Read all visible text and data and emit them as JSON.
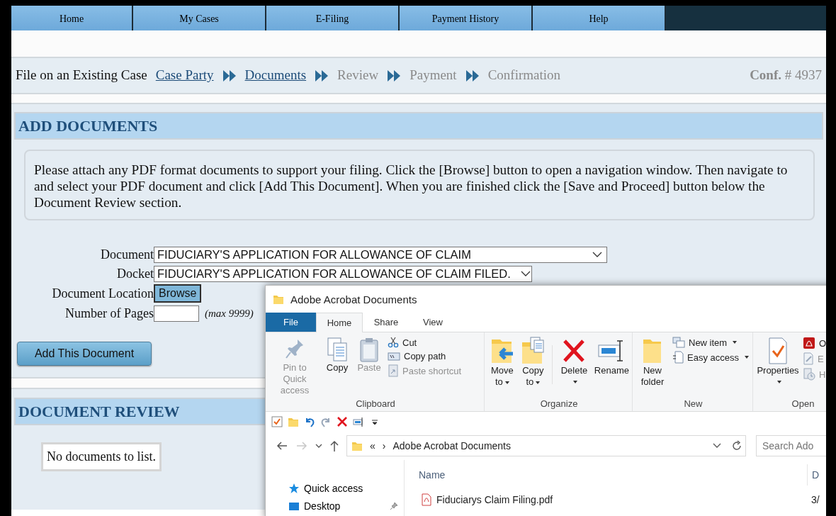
{
  "top_nav": [
    {
      "label": "Home"
    },
    {
      "label": "My Cases"
    },
    {
      "label": "E-Filing"
    },
    {
      "label": "Payment History"
    },
    {
      "label": "Help"
    }
  ],
  "breadcrumb": {
    "title": "File on an Existing Case",
    "steps": [
      {
        "label": "Case Party",
        "done": true
      },
      {
        "label": "Documents",
        "done": true
      },
      {
        "label": "Review",
        "done": false
      },
      {
        "label": "Payment",
        "done": false
      },
      {
        "label": "Confirmation",
        "done": false
      }
    ],
    "conf_label": "Conf.",
    "conf_number": "# 4937"
  },
  "add_documents": {
    "heading": "ADD DOCUMENTS",
    "instructions": "Please attach any PDF format documents to support your filing. Click the [Browse] button to open a navigation window. Then navigate to and select your PDF document and click [Add This Document]. When you are finished click the [Save and Proceed] button below the Document Review section.",
    "fields": [
      {
        "kind": "select",
        "label": "Document",
        "value": "FIDUCIARY'S APPLICATION FOR ALLOWANCE OF CLAIM"
      },
      {
        "kind": "select",
        "label": "Docket",
        "value": "FIDUCIARY'S APPLICATION FOR ALLOWANCE OF CLAIM FILED."
      },
      {
        "kind": "file",
        "label": "Document Location",
        "button": "Browse"
      },
      {
        "kind": "number",
        "label": "Number of Pages",
        "hint": "(max 9999)"
      }
    ],
    "add_button": "Add This Document"
  },
  "document_review": {
    "heading": "DOCUMENT REVIEW",
    "empty_message": "No documents to list."
  },
  "explorer": {
    "title": "Adobe Acrobat Documents",
    "ribbon_tabs": [
      {
        "label": "File",
        "selected": false
      },
      {
        "label": "Home",
        "selected": true
      },
      {
        "label": "Share",
        "selected": false
      },
      {
        "label": "View",
        "selected": false
      }
    ],
    "ribbon_groups": [
      {
        "name": "Clipboard",
        "commands": [
          {
            "label": "Pin to Quick access",
            "kind": "large",
            "disabled": true,
            "dropdown": false
          },
          {
            "label": "Copy",
            "kind": "large",
            "disabled": false,
            "dropdown": false
          },
          {
            "label": "Paste",
            "kind": "large",
            "disabled": true,
            "dropdown": false
          },
          {
            "label": "Cut",
            "kind": "small",
            "disabled": false,
            "dropdown": false
          },
          {
            "label": "Copy path",
            "kind": "small",
            "disabled": false,
            "dropdown": false
          },
          {
            "label": "Paste shortcut",
            "kind": "small",
            "disabled": true,
            "dropdown": false
          }
        ]
      },
      {
        "name": "Organize",
        "commands": [
          {
            "label": "Move to",
            "kind": "large",
            "disabled": false,
            "dropdown": true
          },
          {
            "label": "Copy to",
            "kind": "large",
            "disabled": false,
            "dropdown": true
          },
          {
            "label": "Delete",
            "kind": "large",
            "disabled": false,
            "dropdown": true
          },
          {
            "label": "Rename",
            "kind": "large",
            "disabled": false,
            "dropdown": false
          }
        ]
      },
      {
        "name": "New",
        "commands": [
          {
            "label": "New folder",
            "kind": "large",
            "disabled": false,
            "dropdown": false
          },
          {
            "label": "New item",
            "kind": "small",
            "disabled": false,
            "dropdown": true
          },
          {
            "label": "Easy access",
            "kind": "small",
            "disabled": false,
            "dropdown": true
          }
        ]
      },
      {
        "name": "Open",
        "commands": [
          {
            "label": "Properties",
            "kind": "large",
            "disabled": false,
            "dropdown": true
          },
          {
            "label": "O",
            "kind": "small",
            "disabled": false,
            "dropdown": false
          },
          {
            "label": "E",
            "kind": "small",
            "disabled": true,
            "dropdown": false
          },
          {
            "label": "H",
            "kind": "small",
            "disabled": true,
            "dropdown": false
          }
        ]
      }
    ],
    "address": {
      "overflow": "«",
      "separator": "›",
      "location": "Adobe Acrobat Documents"
    },
    "search": {
      "placeholder": "Search Ado"
    },
    "nav_pane": [
      {
        "label": "Quick access",
        "pinned": false
      },
      {
        "label": "Desktop",
        "pinned": true
      }
    ],
    "columns": [
      "Name",
      "D"
    ],
    "files": [
      {
        "name": "Fiduciarys Claim Filing.pdf",
        "date": "3/"
      }
    ]
  }
}
